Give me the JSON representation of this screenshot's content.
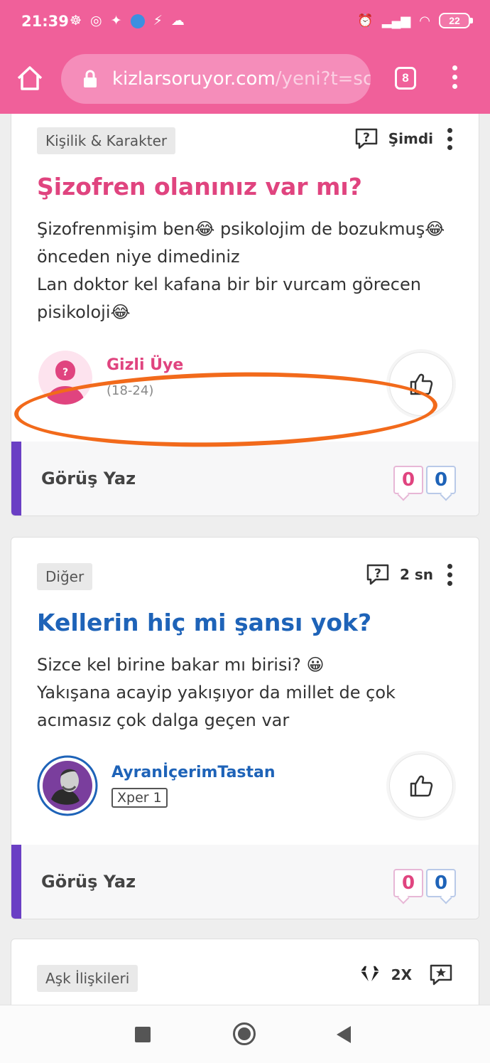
{
  "status_bar": {
    "time": "21:39",
    "battery": "22"
  },
  "browser": {
    "url_main": "kizlarsoruyor.com",
    "url_rest": "/yeni?t=sc",
    "tab_count": "8"
  },
  "posts": [
    {
      "category": "Kişilik & Karakter",
      "time": "Şimdi",
      "title": "Şizofren olanınız var mı?",
      "body_line1": "Şizofrenmişim ben😂 psikolojim de bozukmuş😂",
      "body_line2": "önceden niye dimediniz",
      "body_line3": "Lan doktor kel kafana bir bir vurcam görecen",
      "body_line4": "pisikoloji😂",
      "user_name": "Gizli Üye",
      "user_age": "(18-24)",
      "write_opinion": "Görüş Yaz",
      "count_a": "0",
      "count_b": "0",
      "accent_color": "#e0447f"
    },
    {
      "category": "Diğer",
      "time": "2 sn",
      "title": "Kellerin hiç mi şansı yok?",
      "body_line1": "Sizce kel birine bakar mı birisi? 😀",
      "body_line2": "Yakışana acayip yakışıyor da millet de çok",
      "body_line3": "acımasız çok dalga geçen var",
      "user_name": "AyranİçerimTastan",
      "user_badge": "Xper 1",
      "write_opinion": "Görüş Yaz",
      "count_a": "0",
      "count_b": "0",
      "accent_color": "#1e63b8"
    },
    {
      "category": "Aşk İlişkileri",
      "multiplier": "2X"
    }
  ]
}
